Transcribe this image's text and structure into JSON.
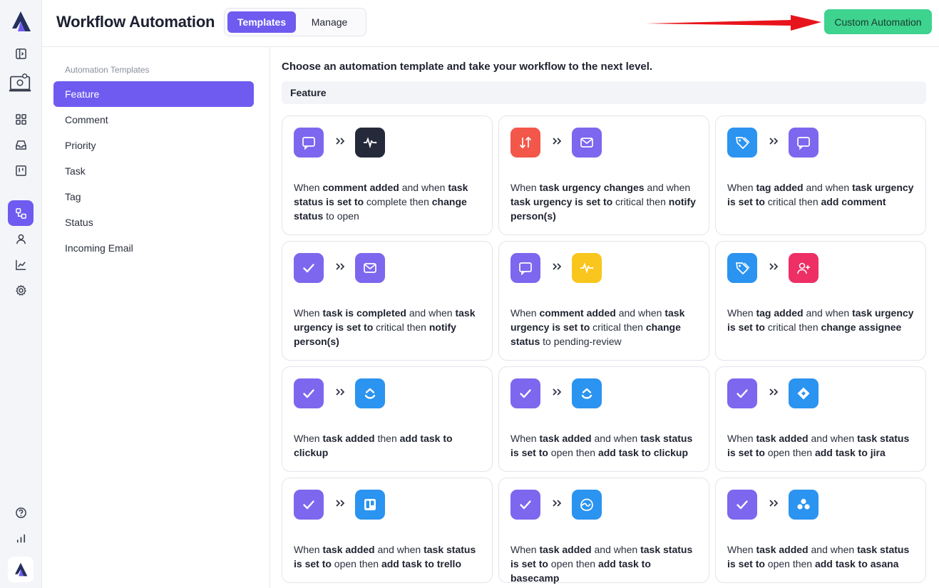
{
  "header": {
    "title": "Workflow Automation",
    "tabs": [
      {
        "label": "Templates"
      },
      {
        "label": "Manage"
      }
    ],
    "custom_button": "Custom Automation"
  },
  "subnav": {
    "heading": "Automation Templates",
    "items": [
      {
        "label": "Feature"
      },
      {
        "label": "Comment"
      },
      {
        "label": "Priority"
      },
      {
        "label": "Task"
      },
      {
        "label": "Tag"
      },
      {
        "label": "Status"
      },
      {
        "label": "Incoming Email"
      }
    ]
  },
  "main": {
    "intro": "Choose an automation template and take your workflow to the next level.",
    "section": "Feature"
  },
  "colors": {
    "accent": "#6f5bf0",
    "cta": "#3ed38f",
    "arrow": "#e8141b"
  },
  "cards": [
    {
      "icon1": "comment-icon",
      "icon2": "activity-icon",
      "parts": [
        [
          "When ",
          ""
        ],
        [
          "comment added",
          "b"
        ],
        [
          " and when ",
          ""
        ],
        [
          "task status is set to",
          "b"
        ],
        [
          " complete then ",
          ""
        ],
        [
          "change status",
          "b"
        ],
        [
          " to open",
          ""
        ]
      ]
    },
    {
      "icon1": "sort-arrows-icon",
      "icon2": "mail-icon",
      "parts": [
        [
          "When ",
          ""
        ],
        [
          "task urgency changes",
          "b"
        ],
        [
          " and when ",
          ""
        ],
        [
          "task urgency is set to",
          "b"
        ],
        [
          " critical then ",
          ""
        ],
        [
          "notify person(s)",
          "b"
        ]
      ]
    },
    {
      "icon1": "tag-icon",
      "icon2": "comment-icon",
      "parts": [
        [
          "When ",
          ""
        ],
        [
          "tag added",
          "b"
        ],
        [
          " and when ",
          ""
        ],
        [
          "task urgency is set to",
          "b"
        ],
        [
          " critical then ",
          ""
        ],
        [
          "add comment",
          "b"
        ]
      ]
    },
    {
      "icon1": "check-icon",
      "icon2": "mail-icon",
      "parts": [
        [
          "When ",
          ""
        ],
        [
          "task is completed",
          "b"
        ],
        [
          " and when ",
          ""
        ],
        [
          "task urgency is set to",
          "b"
        ],
        [
          " critical then ",
          ""
        ],
        [
          "notify person(s)",
          "b"
        ]
      ]
    },
    {
      "icon1": "comment-icon",
      "icon2": "activity-icon",
      "parts": [
        [
          "When ",
          ""
        ],
        [
          "comment added",
          "b"
        ],
        [
          " and when ",
          ""
        ],
        [
          "task urgency is set to",
          "b"
        ],
        [
          " critical then ",
          ""
        ],
        [
          "change status",
          "b"
        ],
        [
          " to pending-review",
          ""
        ]
      ]
    },
    {
      "icon1": "tag-icon",
      "icon2": "user-plus-icon",
      "parts": [
        [
          "When ",
          ""
        ],
        [
          "tag added",
          "b"
        ],
        [
          " and when ",
          ""
        ],
        [
          "task urgency is set to",
          "b"
        ],
        [
          " critical then ",
          ""
        ],
        [
          "change assignee",
          "b"
        ]
      ]
    },
    {
      "icon1": "check-icon",
      "icon2": "clickup-icon",
      "parts": [
        [
          "When ",
          ""
        ],
        [
          "task added",
          "b"
        ],
        [
          " then ",
          ""
        ],
        [
          "add task to clickup",
          "b"
        ]
      ]
    },
    {
      "icon1": "check-icon",
      "icon2": "clickup-icon",
      "parts": [
        [
          "When ",
          ""
        ],
        [
          "task added",
          "b"
        ],
        [
          " and when ",
          ""
        ],
        [
          "task status is set to",
          "b"
        ],
        [
          " open then ",
          ""
        ],
        [
          "add task to clickup",
          "b"
        ]
      ]
    },
    {
      "icon1": "check-icon",
      "icon2": "jira-icon",
      "parts": [
        [
          "When ",
          ""
        ],
        [
          "task added",
          "b"
        ],
        [
          " and when ",
          ""
        ],
        [
          "task status is set to",
          "b"
        ],
        [
          " open then ",
          ""
        ],
        [
          "add task to jira",
          "b"
        ]
      ]
    },
    {
      "icon1": "check-icon",
      "icon2": "trello-icon",
      "parts": [
        [
          "When ",
          ""
        ],
        [
          "task added",
          "b"
        ],
        [
          " and when ",
          ""
        ],
        [
          "task status is set to",
          "b"
        ],
        [
          " open then ",
          ""
        ],
        [
          "add task to trello",
          "b"
        ]
      ]
    },
    {
      "icon1": "check-icon",
      "icon2": "basecamp-icon",
      "parts": [
        [
          "When ",
          ""
        ],
        [
          "task added",
          "b"
        ],
        [
          " and when ",
          ""
        ],
        [
          "task status is set to",
          "b"
        ],
        [
          " open then ",
          ""
        ],
        [
          "add task to basecamp",
          "b"
        ]
      ]
    },
    {
      "icon1": "check-icon",
      "icon2": "asana-icon",
      "parts": [
        [
          "When ",
          ""
        ],
        [
          "task added",
          "b"
        ],
        [
          " and when ",
          ""
        ],
        [
          "task status is set to",
          "b"
        ],
        [
          " open then ",
          ""
        ],
        [
          "add task to asana",
          "b"
        ]
      ]
    }
  ]
}
